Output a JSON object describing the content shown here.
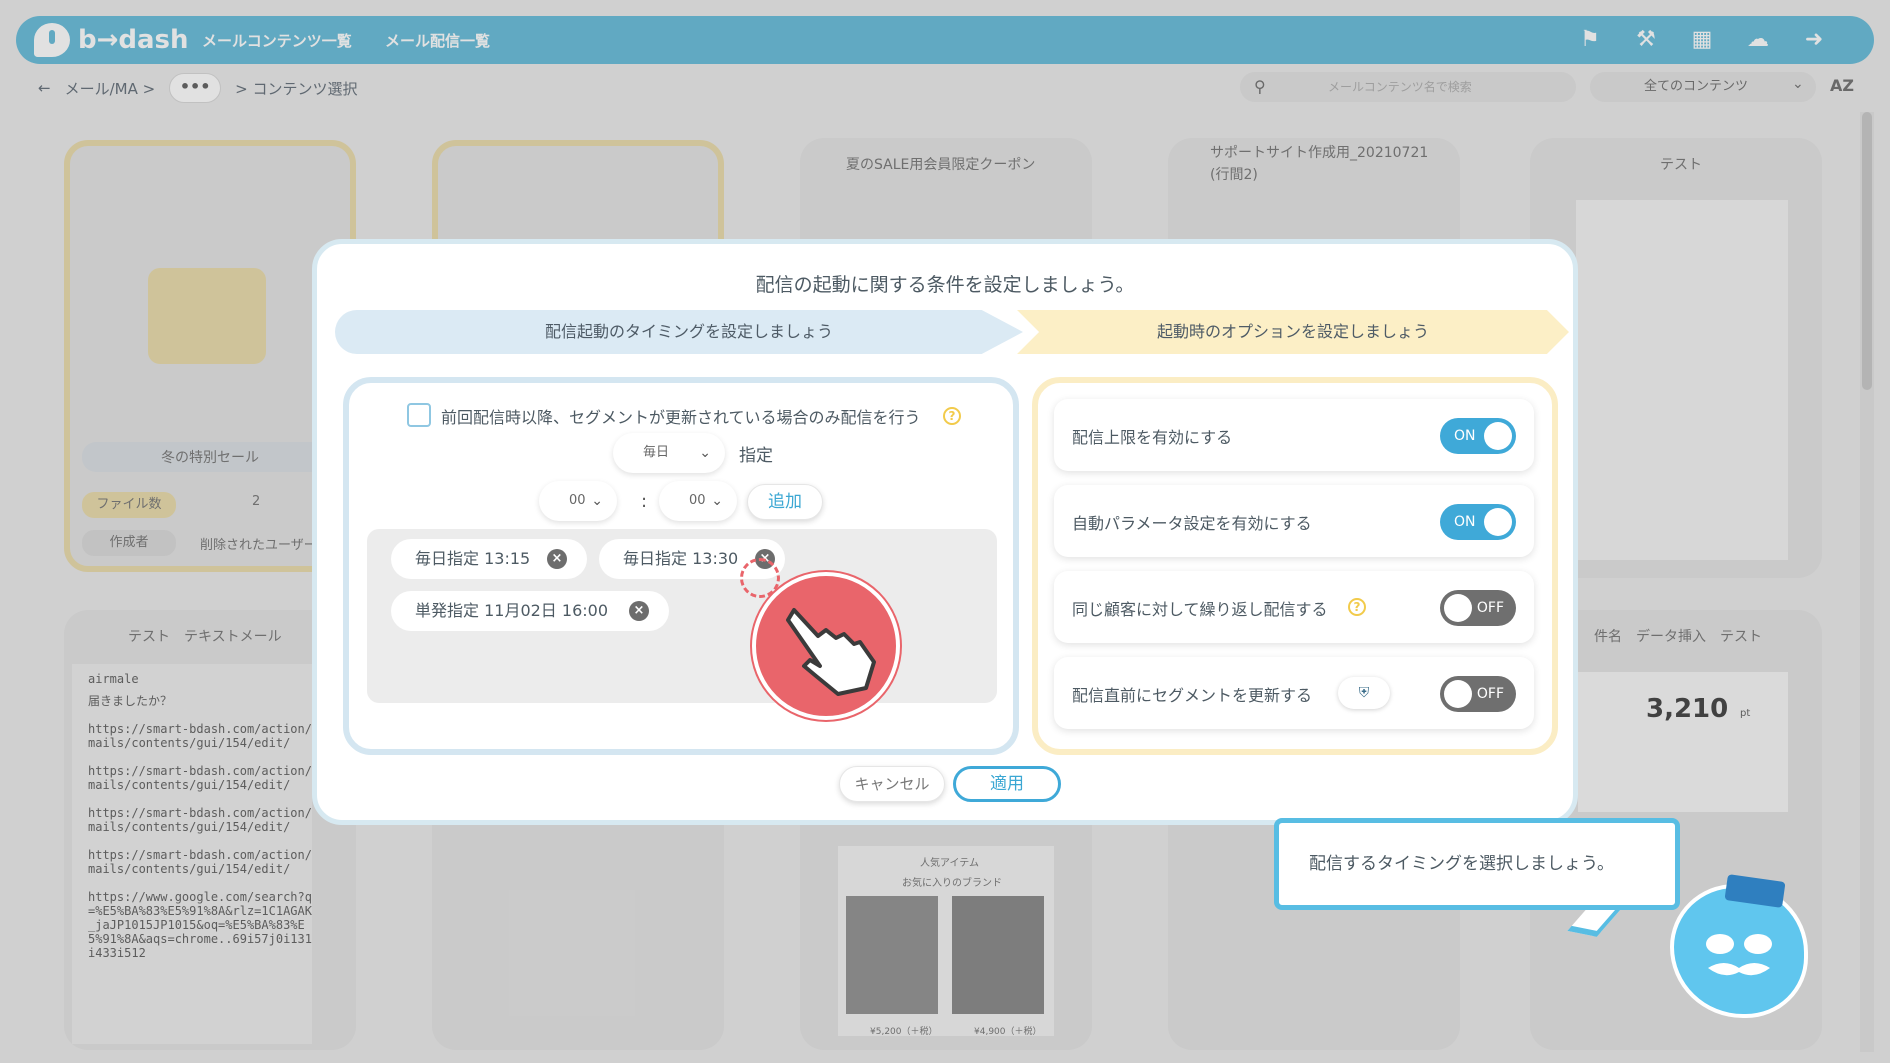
{
  "header": {
    "logo_text": "b→dash",
    "nav": [
      "メールコンテンツ一覧",
      "メール配信一覧"
    ],
    "icons": [
      "bell-icon",
      "wrench-icon",
      "grid-icon",
      "ai-icon",
      "logout-icon"
    ]
  },
  "breadcrumb": {
    "back": "←",
    "items": [
      "メール/MA >",
      "•••",
      "> コンテンツ選択"
    ]
  },
  "toolbar": {
    "search_placeholder": "メールコンテンツ名で検索",
    "filter_value": "全てのコンテンツ",
    "sort_label": "AZ"
  },
  "background": {
    "folder1": {
      "title": "冬の特別セール",
      "file_label": "ファイル数",
      "file_count": "2",
      "author_label": "作成者",
      "author": "削除されたユーザー"
    },
    "card3_title": "夏のSALE用会員限定クーポン",
    "card4_title": "サポートサイト作成用_20210721 (行間2)",
    "card5_title": "テスト",
    "text_card": {
      "title": "テスト　テキストメール",
      "lines": [
        "airmale",
        "届きましたか？",
        "https://smart-bdash.com/action/mails/contents/gui/154/edit/",
        "https://smart-bdash.com/action/mails/contents/gui/154/edit/",
        "https://smart-bdash.com/action/mails/contents/gui/154/edit/",
        "https://smart-bdash.com/action/mails/contents/gui/154/edit/",
        "https://www.google.com/search?q=%E5%BA%83%E5%91%8A&rlz=1C1AGAK_jaJP1015JP1015&oq=%E5%BA%83%E5%91%8A&aqs=chrome..69i57j0i131i433i512"
      ]
    },
    "card_right_title": "件名　データ挿入　テスト",
    "card_right_points": "3,210",
    "card_right_unit": "pt",
    "card_middle_text": [
      "人気アイテム",
      "お気に入りのブランド"
    ],
    "card_middle_prices": [
      "¥5,200（＋税）",
      "¥4,900（＋税）"
    ]
  },
  "modal": {
    "title": "配信の起動に関する条件を設定しましょう。",
    "step1": "配信起動のタイミングを設定しましょう",
    "step2": "起動時のオプションを設定しましょう",
    "segment_checkbox_label": "前回配信時以降、セグメントが更新されている場合のみ配信を行う",
    "frequency_value": "毎日",
    "frequency_suffix": "指定",
    "hour_value": "00",
    "minute_value": "00",
    "colon": ":",
    "add_label": "追加",
    "chips": [
      "毎日指定 13:15",
      "毎日指定 13:30",
      "単発指定 11月02日 16:00"
    ],
    "options": [
      {
        "label": "配信上限を有効にする",
        "state": "ON"
      },
      {
        "label": "自動パラメータ設定を有効にする",
        "state": "ON"
      },
      {
        "label": "同じ顧客に対して繰り返し配信する",
        "state": "OFF"
      },
      {
        "label": "配信直前にセグメントを更新する",
        "state": "OFF"
      }
    ],
    "cancel_label": "キャンセル",
    "apply_label": "適用"
  },
  "tooltip": {
    "text": "配信するタイミングを選択しましょう。"
  },
  "colors": {
    "brand": "#5cb8d8",
    "toggle_on": "#3fa9d8",
    "toggle_off": "#6f6f6f",
    "pointer": "#e9656b",
    "step2_bg": "#fcefc6"
  }
}
